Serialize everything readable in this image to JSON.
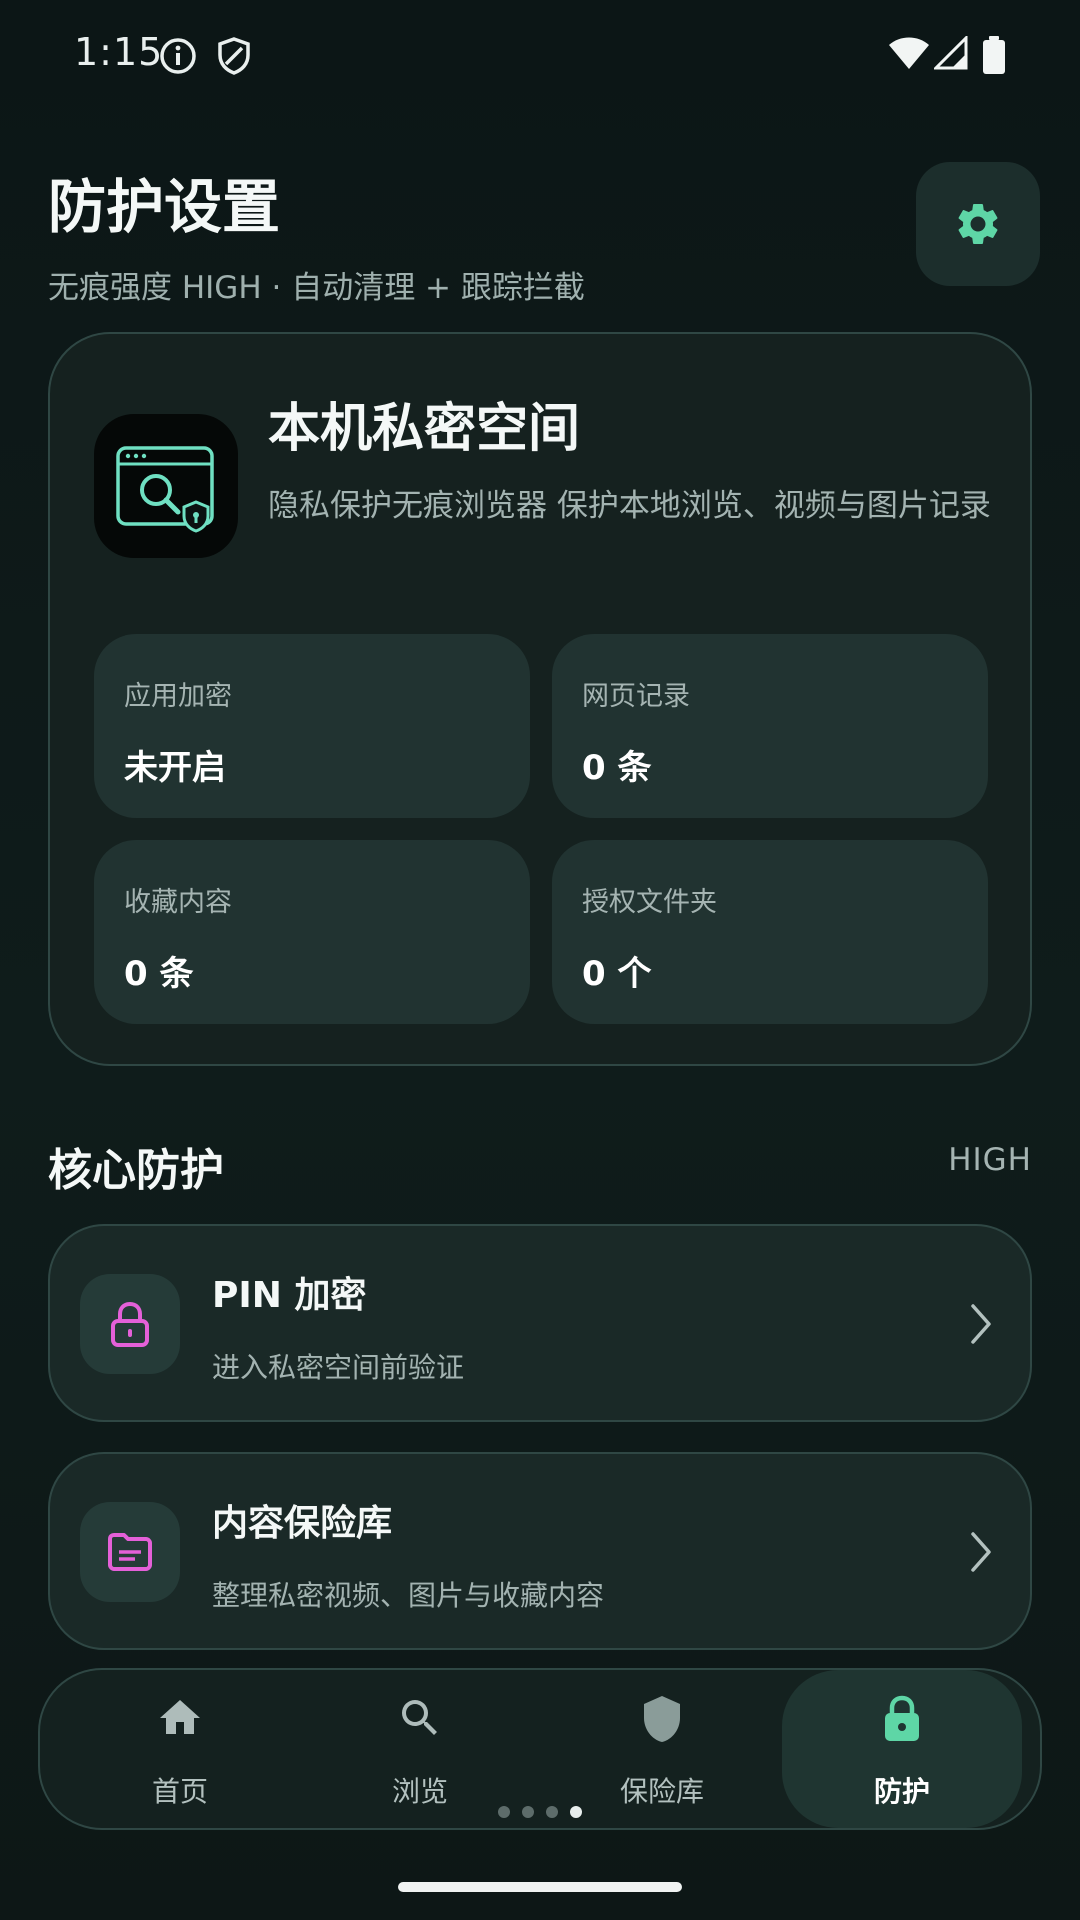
{
  "status_bar": {
    "time": "1:15"
  },
  "header": {
    "title": "防护设置",
    "subtitle": "无痕强度 HIGH · 自动清理 + 跟踪拦截"
  },
  "space_card": {
    "title": "本机私密空间",
    "description": "隐私保护无痕浏览器 保护本地浏览、视频与图片记录",
    "stats": [
      {
        "label": "应用加密",
        "value": "未开启"
      },
      {
        "label": "网页记录",
        "value": "0 条"
      },
      {
        "label": "收藏内容",
        "value": "0 条"
      },
      {
        "label": "授权文件夹",
        "value": "0 个"
      }
    ]
  },
  "core_section": {
    "title": "核心防护",
    "level": "HIGH",
    "items": [
      {
        "title": "PIN 加密",
        "subtitle": "进入私密空间前验证",
        "icon": "lock-icon"
      },
      {
        "title": "内容保险库",
        "subtitle": "整理私密视频、图片与收藏内容",
        "icon": "folder-icon"
      }
    ]
  },
  "bottom_nav": {
    "items": [
      {
        "label": "首页",
        "icon": "home-icon"
      },
      {
        "label": "浏览",
        "icon": "search-icon"
      },
      {
        "label": "保险库",
        "icon": "shield-icon"
      },
      {
        "label": "防护",
        "icon": "lock-icon",
        "selected": true
      }
    ],
    "page_indicator": {
      "count": 4,
      "active": 4
    }
  },
  "colors": {
    "background": "#0d1716",
    "card": "#15211f",
    "tile": "#213331",
    "accent_green": "#5ed6a6",
    "accent_pink": "#e460d8",
    "text_secondary": "#a3b3b1"
  }
}
